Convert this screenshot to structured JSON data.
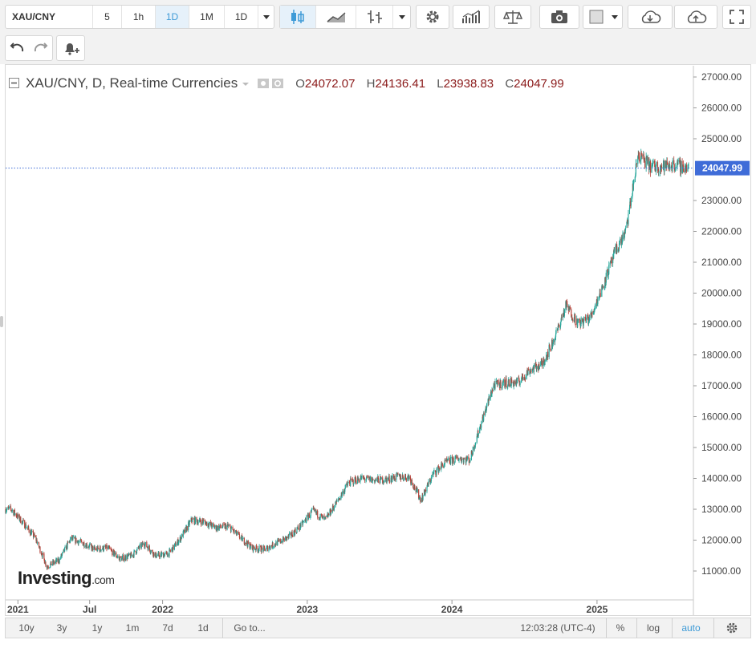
{
  "toolbar": {
    "symbol": "XAU/CNY",
    "intervals": [
      "5",
      "1h",
      "1D",
      "1M",
      "1D"
    ],
    "active_interval_index": 2
  },
  "legend": {
    "title": "XAU/CNY, D, Real-time Currencies",
    "open_label": "O",
    "open": "24072.07",
    "high_label": "H",
    "high": "24136.41",
    "low_label": "L",
    "low": "23938.83",
    "close_label": "C",
    "close": "24047.99"
  },
  "price_axis": {
    "ticks": [
      "27000.00",
      "26000.00",
      "25000.00",
      "23000.00",
      "22000.00",
      "21000.00",
      "20000.00",
      "19000.00",
      "18000.00",
      "17000.00",
      "16000.00",
      "15000.00",
      "14000.00",
      "13000.00",
      "12000.00",
      "11000.00"
    ],
    "last_price_label": "24047.99"
  },
  "time_axis": {
    "labels": [
      "2021",
      "Jul",
      "2022",
      "2023",
      "2024",
      "2025"
    ]
  },
  "watermark": {
    "brand": "Investing",
    "suffix": ".com"
  },
  "bottom_bar": {
    "ranges": [
      "10y",
      "3y",
      "1y",
      "1m",
      "7d",
      "1d"
    ],
    "goto": "Go to...",
    "time": "12:03:28 (UTC-4)",
    "percent": "%",
    "log": "log",
    "auto": "auto"
  },
  "colors": {
    "up": "#26a69a",
    "down": "#b5443b",
    "accent": "#3f9bd7",
    "price_line": "#3f6cd8"
  },
  "chart_data": {
    "type": "candlestick",
    "title": "XAU/CNY, D, Real-time Currencies",
    "ylim": [
      10000,
      27300
    ],
    "x_labels": [
      "2021",
      "Jul",
      "2022",
      "2023",
      "2024",
      "2025"
    ],
    "last": {
      "open": 24072.07,
      "high": 24136.41,
      "low": 23938.83,
      "close": 24047.99
    },
    "series": [
      {
        "date": "2020-12",
        "value": 13000
      },
      {
        "date": "2021-01",
        "value": 12550
      },
      {
        "date": "2021-02",
        "value": 12050
      },
      {
        "date": "2021-03",
        "value": 11150
      },
      {
        "date": "2021-04",
        "value": 11350
      },
      {
        "date": "2021-05",
        "value": 12050
      },
      {
        "date": "2021-06",
        "value": 11900
      },
      {
        "date": "2021-07",
        "value": 11700
      },
      {
        "date": "2021-08",
        "value": 11750
      },
      {
        "date": "2021-09",
        "value": 11400
      },
      {
        "date": "2021-10",
        "value": 11500
      },
      {
        "date": "2021-11",
        "value": 11900
      },
      {
        "date": "2021-12",
        "value": 11500
      },
      {
        "date": "2022-01",
        "value": 11550
      },
      {
        "date": "2022-02",
        "value": 12050
      },
      {
        "date": "2022-03",
        "value": 12650
      },
      {
        "date": "2022-04",
        "value": 12600
      },
      {
        "date": "2022-05",
        "value": 12400
      },
      {
        "date": "2022-06",
        "value": 12450
      },
      {
        "date": "2022-07",
        "value": 12100
      },
      {
        "date": "2022-08",
        "value": 11750
      },
      {
        "date": "2022-09",
        "value": 11700
      },
      {
        "date": "2022-10",
        "value": 11900
      },
      {
        "date": "2022-11",
        "value": 12100
      },
      {
        "date": "2022-12",
        "value": 12450
      },
      {
        "date": "2023-01",
        "value": 12950
      },
      {
        "date": "2023-02",
        "value": 12650
      },
      {
        "date": "2023-03",
        "value": 13200
      },
      {
        "date": "2023-04",
        "value": 13850
      },
      {
        "date": "2023-05",
        "value": 14000
      },
      {
        "date": "2023-06",
        "value": 13950
      },
      {
        "date": "2023-07",
        "value": 13950
      },
      {
        "date": "2023-08",
        "value": 14050
      },
      {
        "date": "2023-09",
        "value": 14050
      },
      {
        "date": "2023-10",
        "value": 13300
      },
      {
        "date": "2023-11",
        "value": 14150
      },
      {
        "date": "2023-12",
        "value": 14500
      },
      {
        "date": "2024-01",
        "value": 14650
      },
      {
        "date": "2024-02",
        "value": 14600
      },
      {
        "date": "2024-03",
        "value": 15800
      },
      {
        "date": "2024-04",
        "value": 17000
      },
      {
        "date": "2024-05",
        "value": 17100
      },
      {
        "date": "2024-06",
        "value": 17100
      },
      {
        "date": "2024-07",
        "value": 17500
      },
      {
        "date": "2024-08",
        "value": 17700
      },
      {
        "date": "2024-09",
        "value": 18500
      },
      {
        "date": "2024-10",
        "value": 19600
      },
      {
        "date": "2024-11",
        "value": 19000
      },
      {
        "date": "2024-12",
        "value": 19200
      },
      {
        "date": "2025-01",
        "value": 20200
      },
      {
        "date": "2025-02",
        "value": 21300
      },
      {
        "date": "2025-03",
        "value": 22000
      },
      {
        "date": "2025-04",
        "value": 24500
      },
      {
        "date": "2025-05",
        "value": 24100
      },
      {
        "date": "2025-06",
        "value": 24100
      },
      {
        "date": "2025-07",
        "value": 24150
      },
      {
        "date": "2025-08",
        "value": 24050
      }
    ]
  }
}
